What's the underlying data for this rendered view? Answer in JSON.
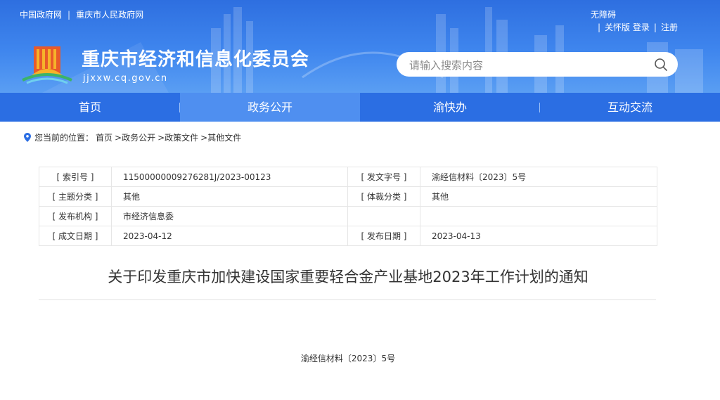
{
  "top_links": [
    "中国政府网",
    "重庆市人民政府网"
  ],
  "top_sep": "|",
  "accessibility": "无障碍",
  "user_links": {
    "care": "关怀版",
    "login": "登录",
    "register": "注册"
  },
  "site": {
    "title": "重庆市经济和信息化委员会",
    "domain": "jjxxw.cq.gov.cn"
  },
  "search": {
    "placeholder": "请输入搜索内容",
    "value": ""
  },
  "nav": [
    {
      "label": "首页"
    },
    {
      "label": "政务公开",
      "active": true
    },
    {
      "label": "渝快办"
    },
    {
      "label": "互动交流"
    }
  ],
  "breadcrumb": {
    "prefix": "您当前的位置：",
    "items": [
      "首页",
      ">政务公开",
      ">政策文件",
      ">其他文件"
    ]
  },
  "meta": [
    {
      "k1": "[ 索引号 ]",
      "v1": "11500000009276281J/2023-00123",
      "k2": "[ 发文字号 ]",
      "v2": "渝经信材料〔2023〕5号"
    },
    {
      "k1": "[ 主题分类 ]",
      "v1": "其他",
      "k2": "[ 体裁分类 ]",
      "v2": "其他"
    },
    {
      "k1": "[ 发布机构 ]",
      "v1": "市经济信息委",
      "k2": "",
      "v2": ""
    },
    {
      "k1": "[ 成文日期 ]",
      "v1": "2023-04-12",
      "k2": "[ 发布日期 ]",
      "v2": "2023-04-13"
    }
  ],
  "article": {
    "title": "关于印发重庆市加快建设国家重要轻合金产业基地2023年工作计划的通知",
    "doc_number": "渝经信材料〔2023〕5号"
  },
  "colors": {
    "header": "#3f86ee",
    "nav": "#2b6ee3",
    "nav_active": "#4f8ff0"
  },
  "icons": [
    "search-icon",
    "location-pin-icon",
    "government-emblem-logo"
  ]
}
